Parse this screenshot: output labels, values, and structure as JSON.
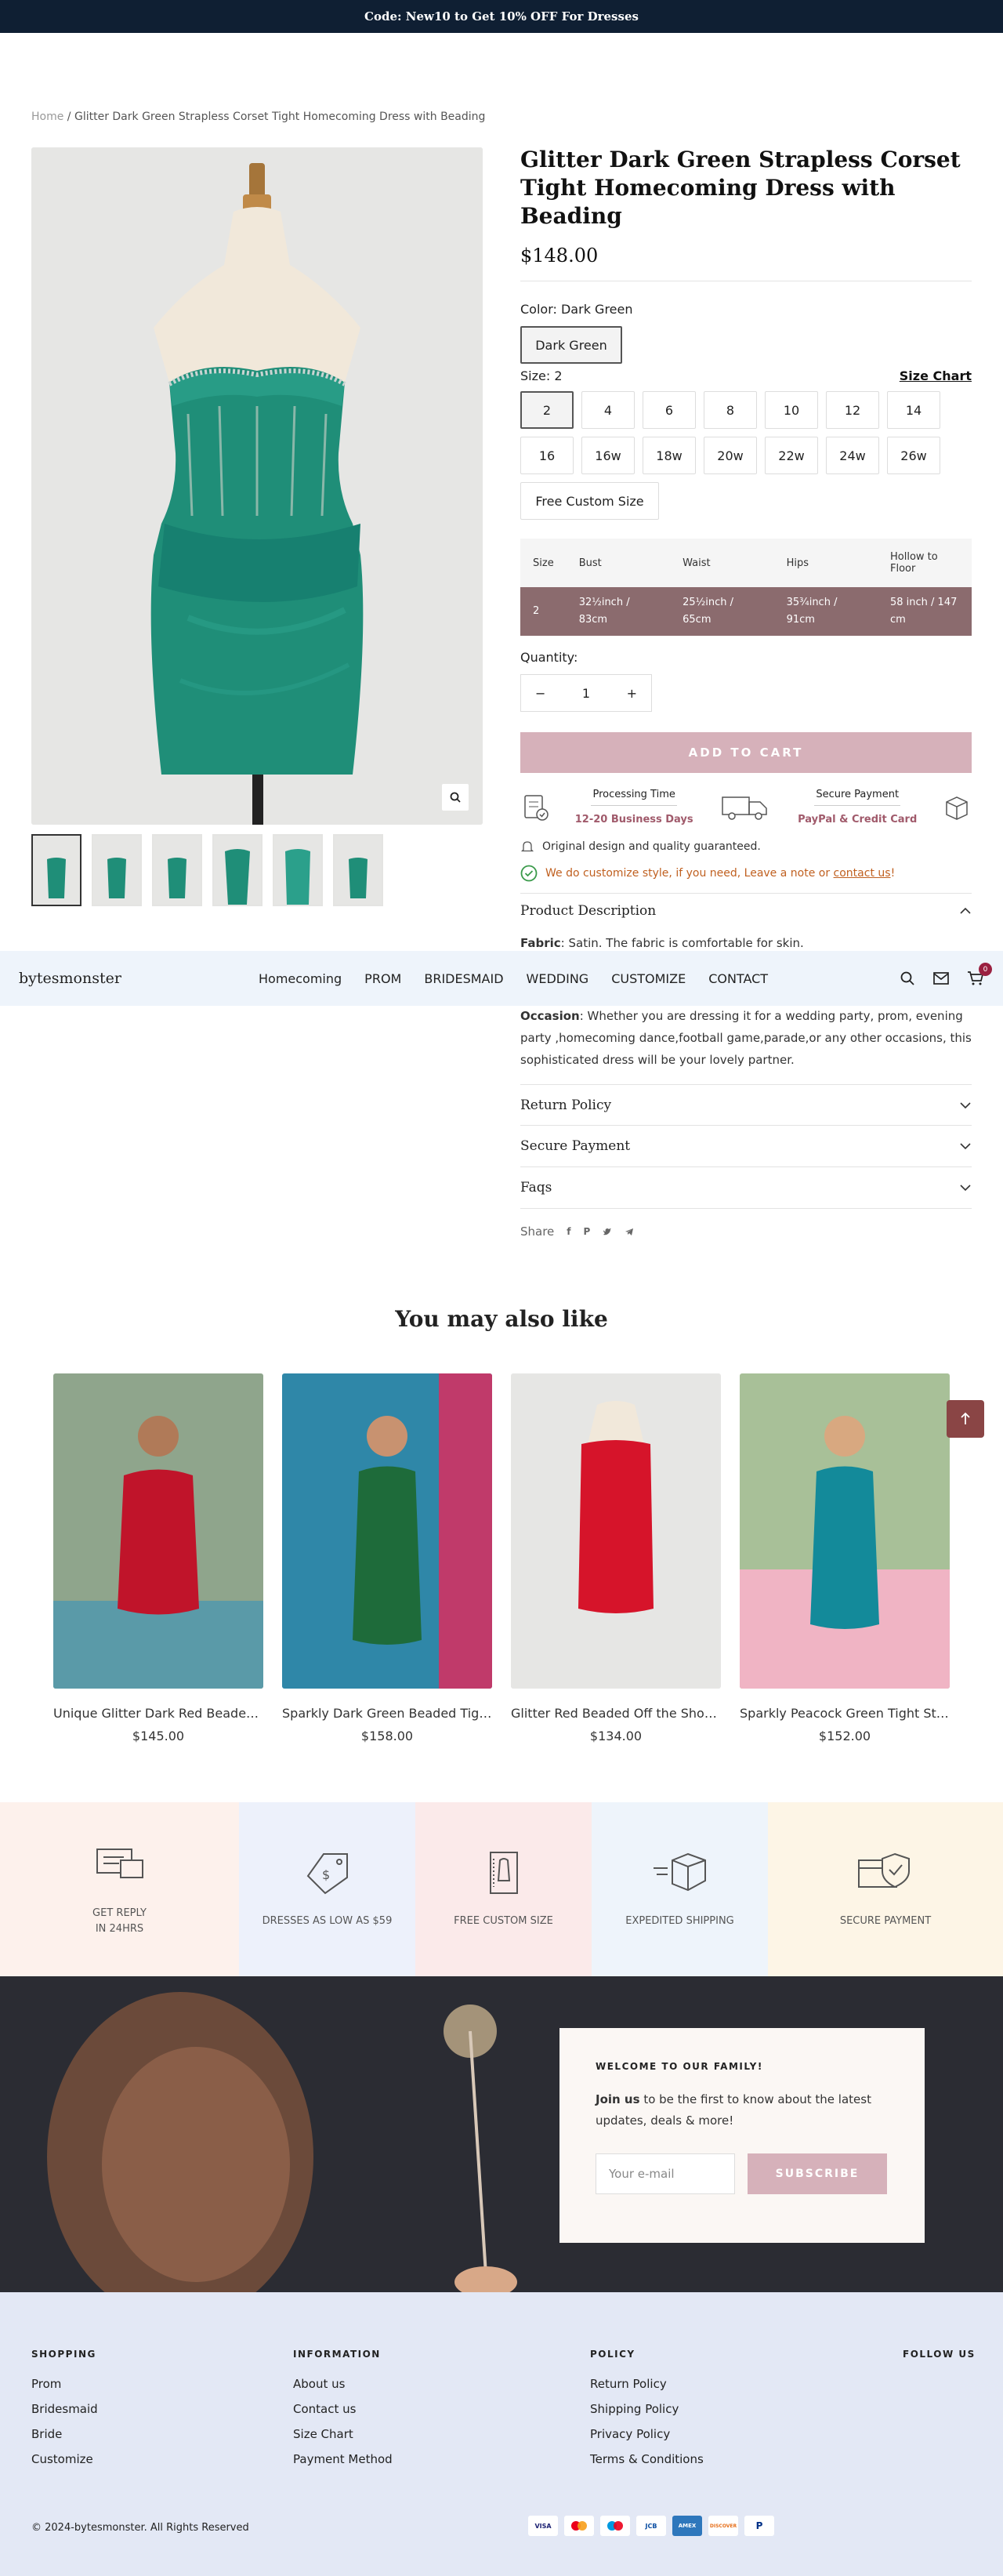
{
  "announcement": "Code: New10 to Get 10% OFF For Dresses",
  "breadcrumb": {
    "home": "Home",
    "sep": " / ",
    "current": "Glitter Dark Green Strapless Corset Tight Homecoming Dress with Beading"
  },
  "product": {
    "title": "Glitter Dark Green Strapless Corset Tight Homecoming Dress with Beading",
    "price": "$148.00",
    "color_label": "Color:",
    "color_value": "Dark Green",
    "color_options": [
      "Dark Green"
    ],
    "size_label": "Size:",
    "size_value": "2",
    "size_chart_label": "Size Chart",
    "sizes": [
      "2",
      "4",
      "6",
      "8",
      "10",
      "12",
      "14",
      "16",
      "16w",
      "18w",
      "20w",
      "22w",
      "24w",
      "26w",
      "Free Custom Size"
    ],
    "size_table": {
      "headers": [
        "Size",
        "Bust",
        "Waist",
        "Hips",
        "Hollow to Floor"
      ],
      "row": [
        "2",
        "32½inch / 83cm",
        "25½inch / 65cm",
        "35¾inch / 91cm",
        "58 inch / 147 cm"
      ]
    },
    "quantity_label": "Quantity:",
    "quantity": "1",
    "add_to_cart": "ADD TO CART",
    "processing_label": "Processing Time",
    "processing_value": "12-20 Business Days",
    "payment_label": "Secure Payment",
    "payment_value": "PayPal & Credit Card",
    "note_original": "Original design and quality guaranteed.",
    "note_custom_prefix": "We do customize style, if you need, Leave a note or ",
    "note_custom_link": "contact us",
    "note_custom_suffix": "!",
    "description_title": "Product Description",
    "fabric_label": "Fabric",
    "fabric_text": ": Satin. The fabric is comfortable for skin.",
    "occasion_label": "Occasion",
    "occasion_text": ": Whether you are dressing it for a wedding party, prom, evening party ,homecoming dance,football game,parade,or any other occasions, this sophisticated dress will be your lovely partner.",
    "accordions": [
      "Return Policy",
      "Secure Payment",
      "Faqs"
    ],
    "share_label": "Share"
  },
  "nav": {
    "logo": "bytesmonster",
    "links": [
      "Homecoming",
      "PROM",
      "BRIDESMAID",
      "WEDDING",
      "CUSTOMIZE",
      "CONTACT"
    ],
    "cart_count": "0"
  },
  "related": {
    "title": "You may also like",
    "items": [
      {
        "name": "Unique Glitter Dark Red Beaded Corset Tight Homecoming Dress",
        "price": "$145.00"
      },
      {
        "name": "Sparkly Dark Green Beaded Tight Homecoming Dress",
        "price": "$158.00"
      },
      {
        "name": "Glitter Red Beaded Off the Shoulder Homecoming Dress",
        "price": "$134.00"
      },
      {
        "name": "Sparkly Peacock Green Tight Strapless Homecoming Dress",
        "price": "$152.00"
      }
    ]
  },
  "perks": [
    {
      "line1": "GET REPLY",
      "line2": "IN 24HRS",
      "bg": "#fdf1ec"
    },
    {
      "line1": "DRESSES AS LOW AS $59",
      "line2": "",
      "bg": "#edf1fb"
    },
    {
      "line1": "FREE CUSTOM SIZE",
      "line2": "",
      "bg": "#fbeaea"
    },
    {
      "line1": "EXPEDITED SHIPPING",
      "line2": "",
      "bg": "#eef4fb"
    },
    {
      "line1": "SECURE PAYMENT",
      "line2": "",
      "bg": "#fdf5e6"
    }
  ],
  "newsletter": {
    "heading": "WELCOME TO OUR FAMILY!",
    "bold": "Join us",
    "text": " to be the first to know about the latest updates, deals & more!",
    "placeholder": "Your e-mail",
    "button": "SUBSCRIBE"
  },
  "footer": {
    "shopping": {
      "title": "SHOPPING",
      "links": [
        "Prom",
        "Bridesmaid",
        "Bride",
        "Customize"
      ]
    },
    "information": {
      "title": "INFORMATION",
      "links": [
        "About us",
        "Contact us",
        "Size Chart",
        "Payment Method"
      ]
    },
    "policy": {
      "title": "POLICY",
      "links": [
        "Return Policy",
        "Shipping Policy",
        "Privacy Policy",
        "Terms & Conditions"
      ]
    },
    "follow": "FOLLOW US",
    "copyright": "© 2024-bytesmonster. All Rights Reserved",
    "payments": [
      "VISA",
      "MC",
      "Maestro",
      "JCB",
      "AMEX",
      "DISCOVER",
      "P"
    ]
  },
  "colors": {
    "accent": "#d6b1ba",
    "dark": "#0f1f33",
    "table_row": "#8b6b6e",
    "scroll_top": "#8a4545"
  }
}
